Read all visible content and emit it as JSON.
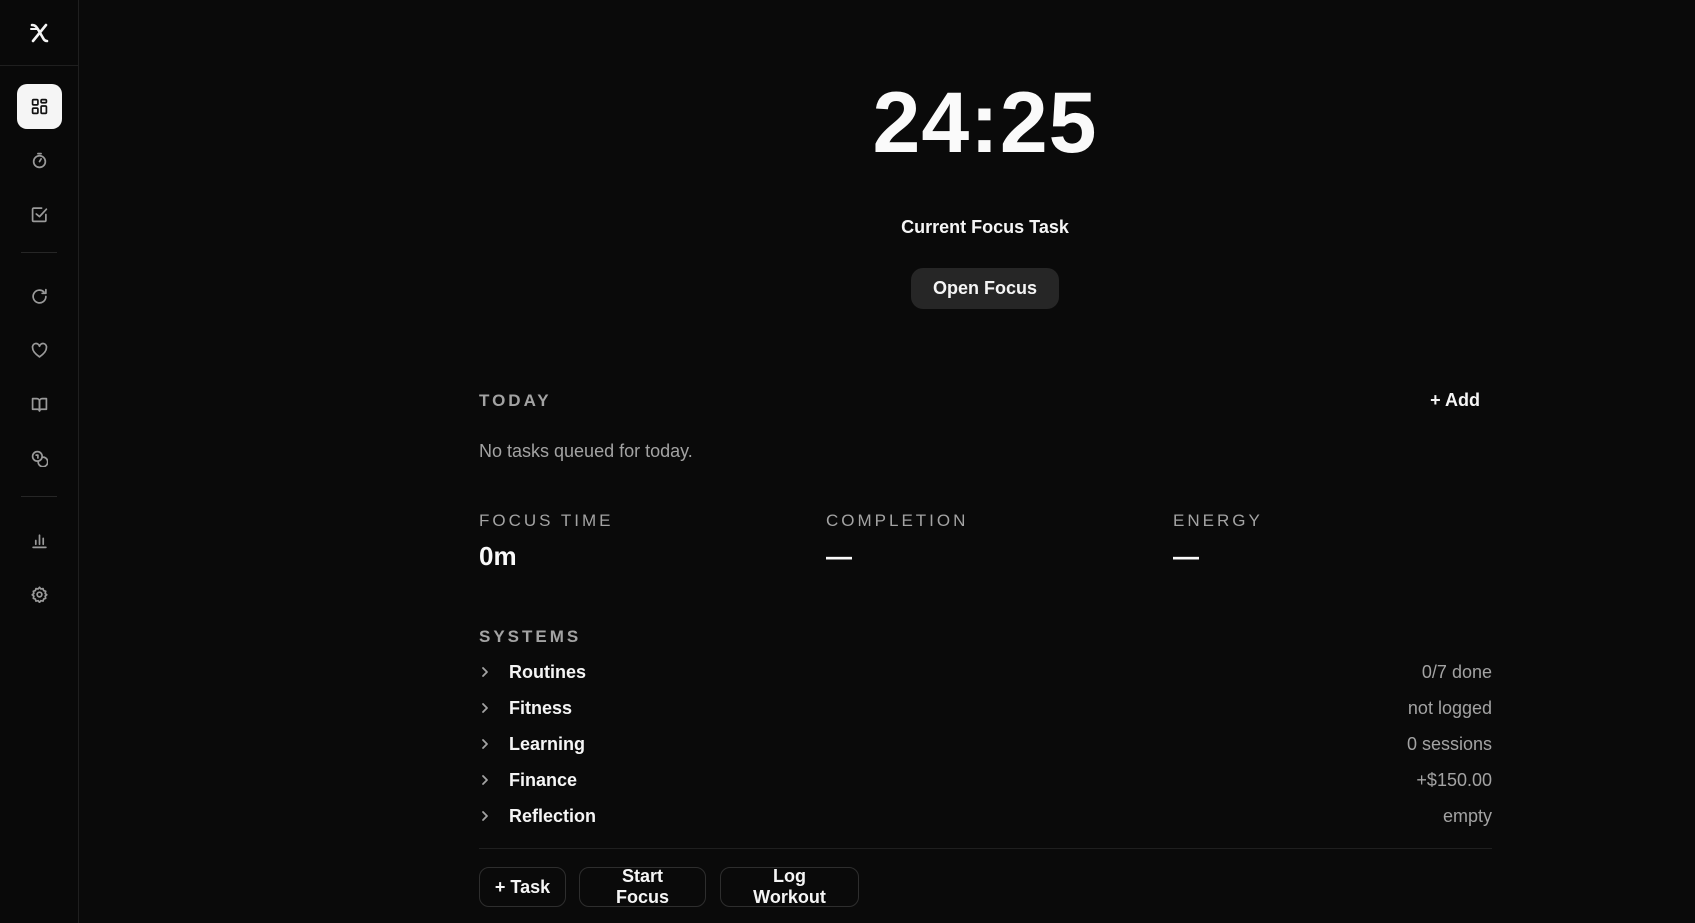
{
  "sidebar": {
    "logo_icon": "x-logo-icon",
    "items": [
      {
        "icon": "dashboard-grid-icon",
        "active": true
      },
      {
        "icon": "stopwatch-icon"
      },
      {
        "icon": "checkbox-icon"
      },
      {
        "icon": "refresh-icon"
      },
      {
        "icon": "heart-icon"
      },
      {
        "icon": "book-icon"
      },
      {
        "icon": "coins-icon"
      },
      {
        "icon": "bar-chart-icon"
      },
      {
        "icon": "gear-icon"
      }
    ]
  },
  "timer": {
    "display": "24:25",
    "task_label": "Current Focus Task",
    "open_button": "Open Focus"
  },
  "today": {
    "heading": "TODAY",
    "add_label": "+ Add",
    "empty_message": "No tasks queued for today."
  },
  "stats": [
    {
      "label": "FOCUS TIME",
      "value": "0m"
    },
    {
      "label": "COMPLETION",
      "value": "—"
    },
    {
      "label": "ENERGY",
      "value": "—"
    }
  ],
  "systems": {
    "heading": "SYSTEMS",
    "rows": [
      {
        "name": "Routines",
        "status": "0/7 done"
      },
      {
        "name": "Fitness",
        "status": "not logged"
      },
      {
        "name": "Learning",
        "status": "0 sessions"
      },
      {
        "name": "Finance",
        "status": "+$150.00"
      },
      {
        "name": "Reflection",
        "status": "empty"
      }
    ]
  },
  "actions": {
    "add_task": "+ Task",
    "start_focus": "Start Focus",
    "log_workout": "Log Workout"
  },
  "colors": {
    "background": "#0a0a0a",
    "text_primary": "#f5f5f5",
    "text_muted": "#a3a3a3",
    "active_nav": "#f5f5f5",
    "button_bg": "#262626"
  }
}
